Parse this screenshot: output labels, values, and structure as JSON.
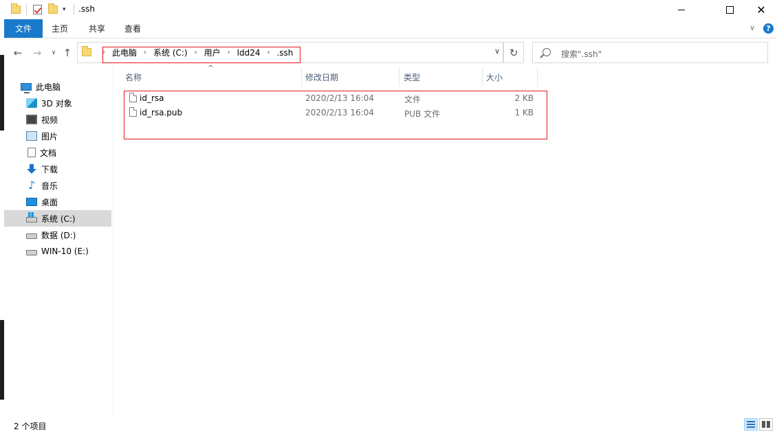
{
  "window": {
    "title": ".ssh",
    "controls": {
      "minimize": "minimize-icon",
      "maximize": "maximize-icon",
      "close": "close-icon"
    }
  },
  "ribbon": {
    "tabs": [
      "文件",
      "主页",
      "共享",
      "查看"
    ],
    "help_label": "?"
  },
  "address": {
    "breadcrumbs": [
      "此电脑",
      "系统 (C:)",
      "用户",
      "ldd24",
      ".ssh"
    ]
  },
  "search": {
    "placeholder": "搜索\".ssh\""
  },
  "sidebar": {
    "items": [
      {
        "label": "此电脑",
        "icon": "computer-icon"
      },
      {
        "label": "3D 对象",
        "icon": "3d-objects-icon"
      },
      {
        "label": "视频",
        "icon": "video-icon"
      },
      {
        "label": "图片",
        "icon": "pictures-icon"
      },
      {
        "label": "文档",
        "icon": "documents-icon"
      },
      {
        "label": "下载",
        "icon": "download-icon"
      },
      {
        "label": "音乐",
        "icon": "music-icon"
      },
      {
        "label": "桌面",
        "icon": "desktop-icon"
      },
      {
        "label": "系统 (C:)",
        "icon": "windows-drive-icon",
        "selected": true
      },
      {
        "label": "数据 (D:)",
        "icon": "drive-icon"
      },
      {
        "label": "WIN-10 (E:)",
        "icon": "drive-icon"
      }
    ]
  },
  "columns": {
    "name": "名称",
    "date": "修改日期",
    "type": "类型",
    "size": "大小"
  },
  "files": [
    {
      "name": "id_rsa",
      "date": "2020/2/13 16:04",
      "type": "文件",
      "size": "2 KB"
    },
    {
      "name": "id_rsa.pub",
      "date": "2020/2/13 16:04",
      "type": "PUB 文件",
      "size": "1 KB"
    }
  ],
  "status": {
    "item_count": "2 个项目"
  },
  "colors": {
    "accent": "#1979ca",
    "highlight": "#e2151f",
    "selected": "#d9d9d9"
  }
}
